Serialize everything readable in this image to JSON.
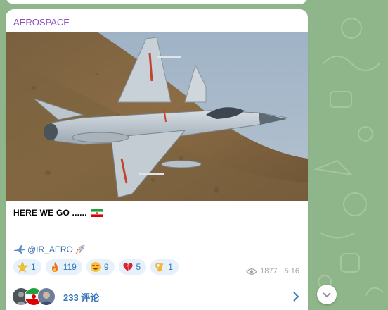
{
  "channel": {
    "name": "AEROSPACE"
  },
  "message": {
    "text": "HERE WE GO ......",
    "mention": "@IR_AERO",
    "views": "1877",
    "time": "5:16"
  },
  "reactions": [
    {
      "emoji": "star-icon",
      "count": "1"
    },
    {
      "emoji": "fire-icon",
      "count": "119"
    },
    {
      "emoji": "heart-eyes-icon",
      "count": "9"
    },
    {
      "emoji": "broken-heart-icon",
      "count": "5"
    },
    {
      "emoji": "ok-hand-icon",
      "count": "1"
    }
  ],
  "comments": {
    "label": "233 评论"
  },
  "colors": {
    "channel": "#8e4ec6",
    "link": "#3476b8",
    "wallpaper": "#8fb58a",
    "reaction_bg": "#e7f1fb"
  }
}
